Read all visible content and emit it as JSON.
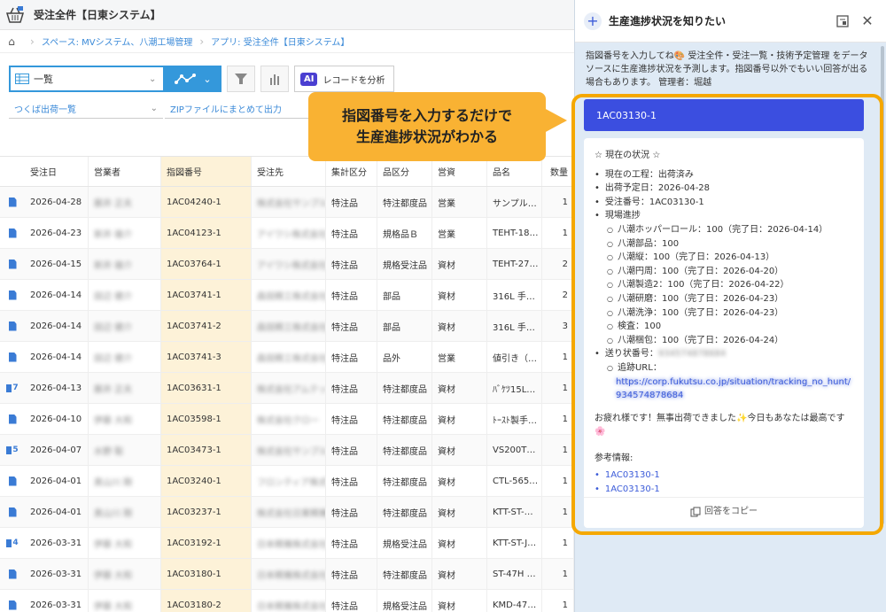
{
  "app": {
    "title": "受注全件【日東システム】"
  },
  "breadcrumb": {
    "home_icon": "home-icon",
    "space": "スペース: MVシステム、八潮工場管理",
    "app": "アプリ: 受注全件【日東システム】"
  },
  "toolbar": {
    "view_label": "一覧",
    "ai_badge": "AI",
    "ai_label": "レコードを分析"
  },
  "filters": {
    "filter1": "つくば出荷一覧",
    "filter2": "ZIPファイルにまとめて出力"
  },
  "callout": {
    "line1": "指図番号を入力するだけで",
    "line2": "生産進捗状況がわかる"
  },
  "table": {
    "headers": [
      "受注日",
      "営業者",
      "指図番号",
      "受注先",
      "集計区分",
      "品区分",
      "営資",
      "品名",
      "数量"
    ],
    "rows": [
      {
        "icon": "doc",
        "date": "2026-04-28",
        "sales": "藤井 正夫",
        "num": "1AC04240-1",
        "cust": "株式会社サンプル",
        "agg": "特注品",
        "cat": "特注都度品",
        "mat": "営業",
        "name": "サンプル…",
        "qty": "1"
      },
      {
        "icon": "doc",
        "date": "2026-04-23",
        "sales": "新井 雄介",
        "num": "1AC04123-1",
        "cust": "アイワシ株式会社",
        "agg": "特注品",
        "cat": "規格品Ｂ",
        "mat": "営業",
        "name": "TEHT-18…",
        "qty": "1"
      },
      {
        "icon": "doc",
        "date": "2026-04-15",
        "sales": "新井 雄介",
        "num": "1AC03764-1",
        "cust": "アイワシ株式会社",
        "agg": "特注品",
        "cat": "規格受注品",
        "mat": "資材",
        "name": "TEHT-27…",
        "qty": "2"
      },
      {
        "icon": "doc",
        "date": "2026-04-14",
        "sales": "田辺 健介",
        "num": "1AC03741-1",
        "cust": "森田精工株式会社",
        "agg": "特注品",
        "cat": "部品",
        "mat": "資材",
        "name": "316L 手…",
        "qty": "2"
      },
      {
        "icon": "doc",
        "date": "2026-04-14",
        "sales": "田辺 健介",
        "num": "1AC03741-2",
        "cust": "森田精工株式会社",
        "agg": "特注品",
        "cat": "部品",
        "mat": "資材",
        "name": "316L 手…",
        "qty": "3"
      },
      {
        "icon": "doc",
        "date": "2026-04-14",
        "sales": "田辺 健介",
        "num": "1AC03741-3",
        "cust": "森田精工株式会社",
        "agg": "特注品",
        "cat": "品外",
        "mat": "営業",
        "name": "値引き（…",
        "qty": "1"
      },
      {
        "icon": "tag7",
        "date": "2026-04-13",
        "sales": "藤井 正夫",
        "num": "1AC03631-1",
        "cust": "株式会社アムテック",
        "agg": "特注品",
        "cat": "特注都度品",
        "mat": "資材",
        "name": "ﾊﾞｹﾂ15L…",
        "qty": "1"
      },
      {
        "icon": "doc",
        "date": "2026-04-10",
        "sales": "伊藤 大和",
        "num": "1AC03598-1",
        "cust": "株式会社クロー",
        "agg": "特注品",
        "cat": "特注都度品",
        "mat": "資材",
        "name": "ﾄｰｽﾄ製手…",
        "qty": "1"
      },
      {
        "icon": "tag5",
        "date": "2026-04-07",
        "sales": "水野 聡",
        "num": "1AC03473-1",
        "cust": "株式会社サンプル",
        "agg": "特注品",
        "cat": "特注都度品",
        "mat": "資材",
        "name": "VS200T…",
        "qty": "1"
      },
      {
        "icon": "doc",
        "date": "2026-04-01",
        "sales": "奥山川 剛",
        "num": "1AC03240-1",
        "cust": "フロンティア株式会社",
        "agg": "特注品",
        "cat": "特注都度品",
        "mat": "資材",
        "name": "CTL-565…",
        "qty": "1"
      },
      {
        "icon": "doc",
        "date": "2026-04-01",
        "sales": "奥山川 剛",
        "num": "1AC03237-1",
        "cust": "株式会社日東精機",
        "agg": "特注品",
        "cat": "特注都度品",
        "mat": "資材",
        "name": "KTT-ST-…",
        "qty": "1"
      },
      {
        "icon": "tag4",
        "date": "2026-03-31",
        "sales": "伊藤 大和",
        "num": "1AC03192-1",
        "cust": "日本精機株式会社",
        "agg": "特注品",
        "cat": "規格受注品",
        "mat": "資材",
        "name": "KTT-ST-J…",
        "qty": "1"
      },
      {
        "icon": "doc",
        "date": "2026-03-31",
        "sales": "伊藤 大和",
        "num": "1AC03180-1",
        "cust": "日本精機株式会社",
        "agg": "特注品",
        "cat": "特注都度品",
        "mat": "資材",
        "name": "ST-47H …",
        "qty": "1"
      },
      {
        "icon": "doc",
        "date": "2026-03-31",
        "sales": "伊藤 大和",
        "num": "1AC03180-2",
        "cust": "日本精機株式会社",
        "agg": "特注品",
        "cat": "規格受注品",
        "mat": "資材",
        "name": "KMD-47…",
        "qty": "1"
      }
    ]
  },
  "panel": {
    "title": "生産進捗状況を知りたい",
    "description": "指図番号を入力してね🎨 受注全件・受注一覧・技術予定管理 をデータソースに生産進捗状況を予測します。指図番号以外でもいい回答が出る場合もあります。 管理者：堀越",
    "query": "1AC03130-1",
    "answer": {
      "heading": "☆ 現在の状況 ☆",
      "items": [
        "現在の工程：出荷済み",
        "出荷予定日：2026-04-28",
        "受注番号：1AC03130-1",
        "現場進捗"
      ],
      "progress": [
        "八潮ホッパーロール：100（完了日：2026-04-14）",
        "八潮部品：100",
        "八潮縦：100（完了日：2026-04-13）",
        "八潮円周：100（完了日：2026-04-20）",
        "八潮製造2：100（完了日：2026-04-22）",
        "八潮研磨：100（完了日：2026-04-23）",
        "八潮洗浄：100（完了日：2026-04-23）",
        "検査：100",
        "八潮梱包：100（完了日：2026-04-24）"
      ],
      "shipping_label": "送り状番号：",
      "shipping_no": "934574878684",
      "tracking_label": "追跡URL：",
      "tracking_url": "https://corp.fukutsu.co.jp/situation/tracking_no_hunt/934574878684",
      "closing": "お疲れ様です！無事出荷できました✨今日もあなたは最高です🌸",
      "refs_label": "参考情報:",
      "refs": [
        "1AC03130-1",
        "1AC03130-1"
      ],
      "copy_label": "回答をコピー"
    }
  }
}
